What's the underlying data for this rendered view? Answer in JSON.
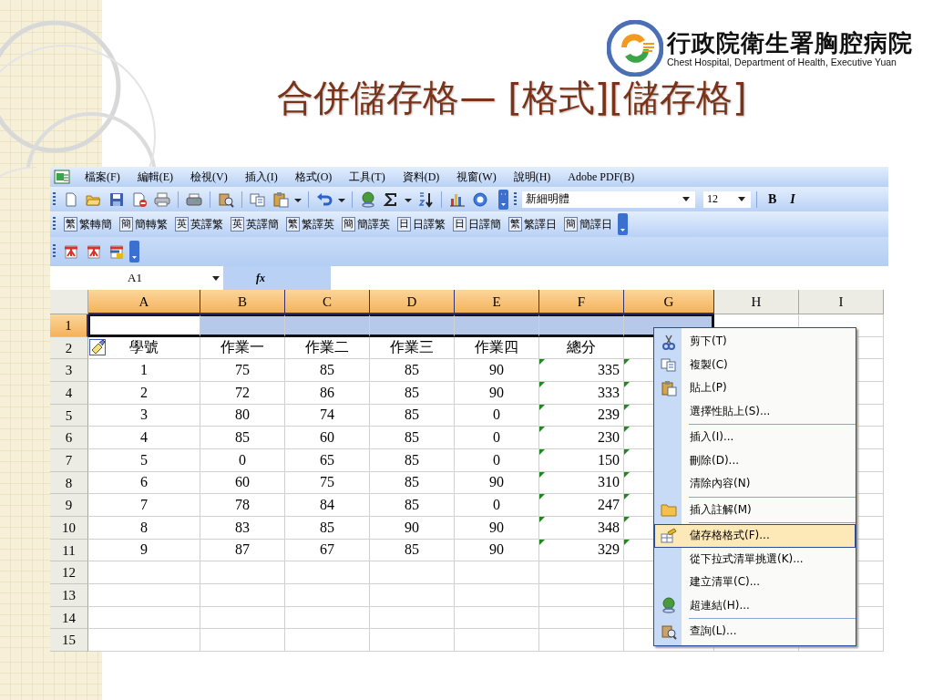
{
  "slide_title": "合併儲存格— [格式][儲存格]",
  "logo": {
    "name": "行政院衛生署胸腔病院",
    "subtitle": "Chest Hospital, Department of Health, Executive Yuan"
  },
  "menu_bar": [
    "檔案(F)",
    "編輯(E)",
    "檢視(V)",
    "插入(I)",
    "格式(O)",
    "工具(T)",
    "資料(D)",
    "視窗(W)",
    "說明(H)",
    "Adobe PDF(B)"
  ],
  "formatting": {
    "font": "新細明體",
    "size": "12",
    "buttons": [
      "B",
      "I"
    ]
  },
  "translate_toolbar": [
    {
      "icon_char": "繁",
      "label": "繁轉簡"
    },
    {
      "icon_char": "簡",
      "label": "簡轉繁"
    },
    {
      "icon_char": "英",
      "label": "英譯繁"
    },
    {
      "icon_char": "英",
      "label": "英譯簡"
    },
    {
      "icon_char": "繁",
      "label": "繁譯英"
    },
    {
      "icon_char": "簡",
      "label": "簡譯英"
    },
    {
      "icon_char": "日",
      "label": "日譯繁"
    },
    {
      "icon_char": "日",
      "label": "日譯簡"
    },
    {
      "icon_char": "繁",
      "label": "繁譯日"
    },
    {
      "icon_char": "簡",
      "label": "簡譯日"
    }
  ],
  "formula_bar": {
    "name_box": "A1",
    "symbol": "fx"
  },
  "sheet": {
    "columns": [
      {
        "label": "A",
        "selected": true
      },
      {
        "label": "B",
        "selected": true
      },
      {
        "label": "C",
        "selected": true
      },
      {
        "label": "D",
        "selected": true
      },
      {
        "label": "E",
        "selected": true
      },
      {
        "label": "F",
        "selected": true,
        "right_aligned": true
      },
      {
        "label": "G",
        "selected": true
      },
      {
        "label": "H",
        "selected": false
      },
      {
        "label": "I",
        "selected": false
      }
    ],
    "rows": [
      {
        "header": "1",
        "selected": true
      },
      {
        "header": "2",
        "selected": false,
        "kind": "heading",
        "paste_tag": true,
        "cells": [
          {
            "text": "學號"
          },
          {
            "text": "作業一"
          },
          {
            "text": "作業二"
          },
          {
            "text": "作業三"
          },
          {
            "text": "作業四"
          },
          {
            "text": "總分"
          }
        ]
      },
      {
        "header": "3",
        "selected": false,
        "cells": [
          {
            "text": "1"
          },
          {
            "text": "75"
          },
          {
            "text": "85"
          },
          {
            "text": "85"
          },
          {
            "text": "90"
          },
          {
            "text": "335",
            "flag": true
          },
          {
            "flag": true
          }
        ]
      },
      {
        "header": "4",
        "selected": false,
        "cells": [
          {
            "text": "2"
          },
          {
            "text": "72"
          },
          {
            "text": "86"
          },
          {
            "text": "85"
          },
          {
            "text": "90"
          },
          {
            "text": "333",
            "flag": true
          },
          {
            "flag": true
          }
        ]
      },
      {
        "header": "5",
        "selected": false,
        "cells": [
          {
            "text": "3"
          },
          {
            "text": "80"
          },
          {
            "text": "74"
          },
          {
            "text": "85"
          },
          {
            "text": "0"
          },
          {
            "text": "239",
            "flag": true
          },
          {
            "flag": true
          }
        ]
      },
      {
        "header": "6",
        "selected": false,
        "cells": [
          {
            "text": "4"
          },
          {
            "text": "85"
          },
          {
            "text": "60"
          },
          {
            "text": "85"
          },
          {
            "text": "0"
          },
          {
            "text": "230",
            "flag": true
          },
          {
            "flag": true
          }
        ]
      },
      {
        "header": "7",
        "selected": false,
        "cells": [
          {
            "text": "5"
          },
          {
            "text": "0"
          },
          {
            "text": "65"
          },
          {
            "text": "85"
          },
          {
            "text": "0"
          },
          {
            "text": "150",
            "flag": true
          },
          {
            "flag": true
          }
        ]
      },
      {
        "header": "8",
        "selected": false,
        "cells": [
          {
            "text": "6"
          },
          {
            "text": "60"
          },
          {
            "text": "75"
          },
          {
            "text": "85"
          },
          {
            "text": "90"
          },
          {
            "text": "310",
            "flag": true
          },
          {
            "flag": true
          }
        ]
      },
      {
        "header": "9",
        "selected": false,
        "cells": [
          {
            "text": "7"
          },
          {
            "text": "78"
          },
          {
            "text": "84"
          },
          {
            "text": "85"
          },
          {
            "text": "0"
          },
          {
            "text": "247",
            "flag": true
          },
          {
            "flag": true
          }
        ]
      },
      {
        "header": "10",
        "selected": false,
        "cells": [
          {
            "text": "8"
          },
          {
            "text": "83"
          },
          {
            "text": "85"
          },
          {
            "text": "90"
          },
          {
            "text": "90"
          },
          {
            "text": "348",
            "flag": true
          },
          {
            "flag": true
          }
        ]
      },
      {
        "header": "11",
        "selected": false,
        "cells": [
          {
            "text": "9"
          },
          {
            "text": "87"
          },
          {
            "text": "67"
          },
          {
            "text": "85"
          },
          {
            "text": "90"
          },
          {
            "text": "329",
            "flag": true
          },
          {
            "flag": true
          }
        ]
      },
      {
        "header": "12",
        "selected": false
      },
      {
        "header": "13",
        "selected": false
      },
      {
        "header": "14",
        "selected": false
      },
      {
        "header": "15",
        "selected": false
      }
    ]
  },
  "context_menu": {
    "groups": [
      [
        {
          "label": "剪下(T)",
          "selected": false
        },
        {
          "label": "複製(C)",
          "selected": false
        },
        {
          "label": "貼上(P)",
          "selected": false
        },
        {
          "label": "選擇性貼上(S)...",
          "selected": false
        }
      ],
      [
        {
          "label": "插入(I)...",
          "selected": false
        },
        {
          "label": "刪除(D)...",
          "selected": false
        },
        {
          "label": "清除內容(N)",
          "selected": false
        }
      ],
      [
        {
          "label": "插入註解(M)",
          "selected": false
        }
      ],
      [
        {
          "label": "儲存格格式(F)...",
          "selected": true
        },
        {
          "label": "從下拉式清單挑選(K)...",
          "selected": false
        },
        {
          "label": "建立清單(C)...",
          "selected": false
        },
        {
          "label": "超連結(H)...",
          "selected": false
        }
      ],
      [
        {
          "label": "查詢(L)...",
          "selected": false
        }
      ]
    ]
  }
}
